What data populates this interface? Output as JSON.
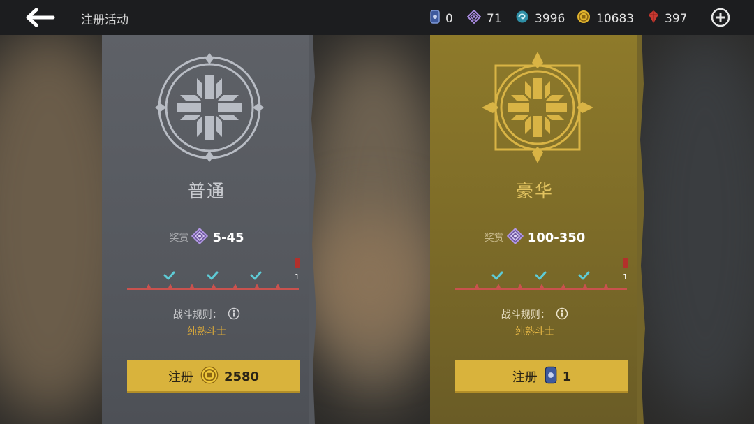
{
  "header": {
    "title": "注册活动",
    "currencies": [
      {
        "icon": "ticket-icon",
        "value": "0"
      },
      {
        "icon": "purple-diamond-icon",
        "value": "71"
      },
      {
        "icon": "blue-swirl-icon",
        "value": "3996"
      },
      {
        "icon": "gold-coin-icon",
        "value": "10683"
      },
      {
        "icon": "red-gem-icon",
        "value": "397"
      }
    ]
  },
  "cards": [
    {
      "title": "普通",
      "reward_label": "奖赏",
      "reward_value": "5-45",
      "progress_end": "1",
      "rules_label": "战斗规则：",
      "rules_value": "纯熟斗士",
      "register_label": "注册",
      "register_cost": "2580",
      "register_cost_icon": "gold-coin-icon",
      "accent": "#d9b33c"
    },
    {
      "title": "豪华",
      "reward_label": "奖赏",
      "reward_value": "100-350",
      "progress_end": "1",
      "rules_label": "战斗规则：",
      "rules_value": "纯熟斗士",
      "register_label": "注册",
      "register_cost": "1",
      "register_cost_icon": "ticket-icon",
      "accent": "#e2c360"
    }
  ]
}
